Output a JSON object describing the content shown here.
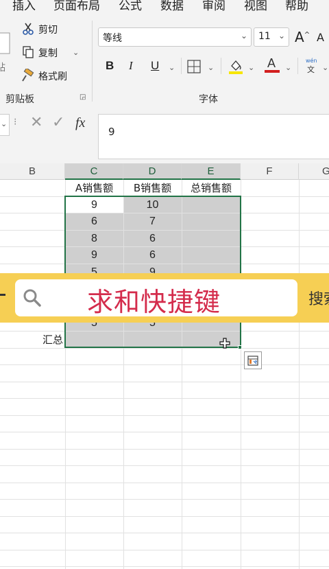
{
  "menu": [
    "插入",
    "页面布局",
    "公式",
    "数据",
    "审阅",
    "视图",
    "帮助"
  ],
  "clipboard": {
    "cut": "剪切",
    "copy": "复制",
    "format_painter": "格式刷",
    "paste_partial": "贴",
    "group_label": "剪贴板"
  },
  "font": {
    "name": "等线",
    "size": "11",
    "bold": "B",
    "italic": "I",
    "underline": "U",
    "font_color_letter": "A",
    "pinyin_top": "wén",
    "pinyin_bottom": "文",
    "group_label": "字体"
  },
  "formula_bar": {
    "fx": "fx",
    "value": "9"
  },
  "columns": [
    "B",
    "C",
    "D",
    "E",
    "F",
    "G"
  ],
  "headers": [
    "A销售额",
    "B销售额",
    "总销售额"
  ],
  "rows": [
    {
      "a": "9",
      "b": "10"
    },
    {
      "a": "6",
      "b": "7"
    },
    {
      "a": "8",
      "b": "6"
    },
    {
      "a": "9",
      "b": "6"
    },
    {
      "a": "5",
      "b": "9"
    },
    {
      "a": "",
      "b": ""
    },
    {
      "a": "",
      "b": ""
    },
    {
      "a": "5",
      "b": "5"
    }
  ],
  "total_label": "汇总",
  "banner": {
    "title": "求和快捷键",
    "extra": "搜索"
  },
  "colors": {
    "accent": "#217346",
    "banner_bg": "#f6cf54",
    "banner_text": "#d42c4c",
    "selection_fill": "#cfcfcf"
  }
}
